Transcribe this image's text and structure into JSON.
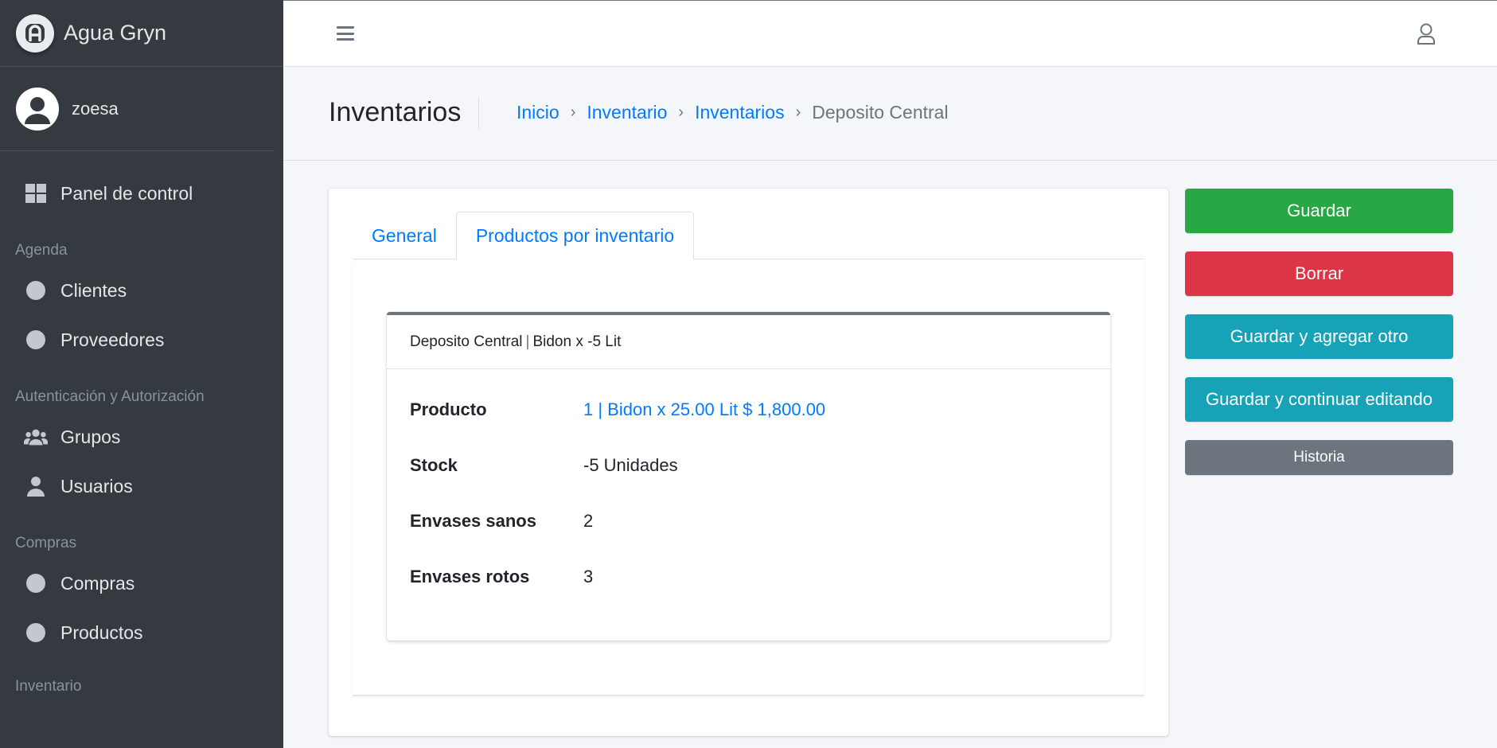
{
  "brand": {
    "name": "Agua Gryn",
    "logo_icon": "brand-logo-icon"
  },
  "user": {
    "name": "zoesa"
  },
  "sidebar": {
    "dashboard": {
      "label": "Panel de control",
      "icon": "grid-icon"
    },
    "sections": [
      {
        "header": "Agenda",
        "items": [
          {
            "label": "Clientes",
            "icon": "circle-icon"
          },
          {
            "label": "Proveedores",
            "icon": "circle-icon"
          }
        ]
      },
      {
        "header": "Autenticación y Autorización",
        "items": [
          {
            "label": "Grupos",
            "icon": "users-icon"
          },
          {
            "label": "Usuarios",
            "icon": "user-icon"
          }
        ]
      },
      {
        "header": "Compras",
        "items": [
          {
            "label": "Compras",
            "icon": "circle-icon"
          },
          {
            "label": "Productos",
            "icon": "circle-icon"
          }
        ]
      },
      {
        "header": "Inventario",
        "items": []
      }
    ]
  },
  "header": {
    "title": "Inventarios",
    "breadcrumb": [
      "Inicio",
      "Inventario",
      "Inventarios",
      "Deposito Central"
    ]
  },
  "tabs": [
    {
      "label": "General",
      "active": false
    },
    {
      "label": "Productos por inventario",
      "active": true
    }
  ],
  "inline": {
    "title_left": "Deposito Central",
    "title_sep": "|",
    "title_right": "Bidon x -5 Lit",
    "fields": [
      {
        "label": "Producto",
        "value": "1 | Bidon x 25.00 Lit $ 1,800.00"
      },
      {
        "label": "Stock",
        "value": "-5 Unidades"
      },
      {
        "label": "Envases sanos",
        "value": "2"
      },
      {
        "label": "Envases rotos",
        "value": "3"
      }
    ]
  },
  "actions": {
    "save": "Guardar",
    "delete": "Borrar",
    "save_add": "Guardar y agregar otro",
    "save_continue": "Guardar y continuar editando",
    "history": "Historia"
  },
  "colors": {
    "sidebar_bg": "#343a40",
    "link": "#007bff",
    "success": "#28a745",
    "danger": "#dc3545",
    "info": "#17a2b8",
    "secondary": "#6c757d"
  }
}
